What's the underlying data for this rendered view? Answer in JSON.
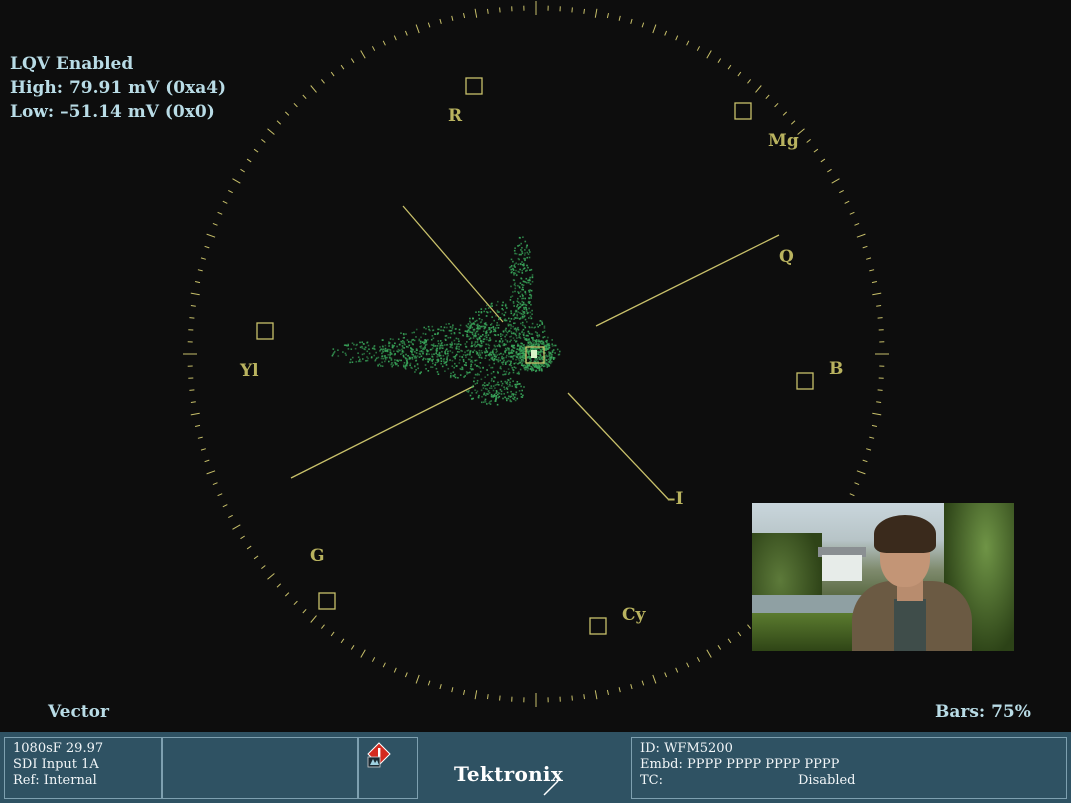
{
  "overlay": {
    "lqv_status": "LQV Enabled",
    "high": "High: 79.91 mV (0xa4)",
    "low": "Low: –51.14 mV (0x0)"
  },
  "graticule": {
    "targets": {
      "R": "R",
      "Mg": "Mg",
      "B": "B",
      "Cy": "Cy",
      "G": "G",
      "Yl": "Yl"
    },
    "axis_labels": {
      "Q": "Q",
      "I": "–I"
    }
  },
  "mode_label": "Vector",
  "bars_label": "Bars: 75%",
  "status": {
    "format": "1080sF 29.97",
    "input": "SDI Input 1A",
    "ref": "Ref: Internal",
    "brand": "Tektronix",
    "id": "ID: WFM5200",
    "embd": "Embd: PPPP PPPP PPPP PPPP",
    "tc_label": "TC:",
    "tc_value": "Disabled"
  },
  "icons": {
    "alarm": "warning-diamond-icon"
  },
  "colors": {
    "graticule": "#c8c06a",
    "trace": "#39a55a",
    "overlay_text": "#b9dce6",
    "status_bar": "#2f5263"
  }
}
